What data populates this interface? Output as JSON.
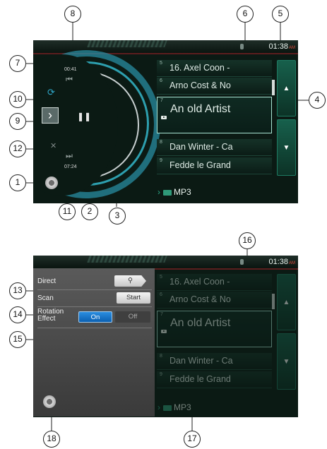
{
  "screen1": {
    "time": "01:38",
    "ampm": "AM",
    "elapsed_time": "00:41",
    "total_time": "07:24",
    "tracks": [
      {
        "num": "5",
        "title": "16. Axel Coon -"
      },
      {
        "num": "6",
        "title": "Arno Cost & No"
      },
      {
        "num": "7",
        "title": "An old  Artist"
      },
      {
        "num": "8",
        "title": "Dan Winter - Ca"
      },
      {
        "num": "9",
        "title": "Fedde le Grand"
      }
    ],
    "folder": "MP3",
    "scroll_up": "▲",
    "scroll_down": "▼",
    "next_icon": "›",
    "pause_icon": "❚❚"
  },
  "screen2": {
    "time": "01:38",
    "ampm": "AM",
    "settings": {
      "direct_label": "Direct",
      "direct_button": "⚲",
      "scan_label": "Scan",
      "scan_button": "Start",
      "rotation_label_1": "Rotation",
      "rotation_label_2": "Effect",
      "rotation_on": "On",
      "rotation_off": "Off"
    },
    "tracks": [
      {
        "num": "5",
        "title": "16. Axel Coon -"
      },
      {
        "num": "6",
        "title": "Arno Cost & No"
      },
      {
        "num": "7",
        "title": "An old  Artist"
      },
      {
        "num": "8",
        "title": "Dan Winter - Ca"
      },
      {
        "num": "9",
        "title": "Fedde le Grand"
      }
    ],
    "folder": "MP3",
    "scroll_up": "▲",
    "scroll_down": "▼"
  },
  "callouts": [
    "1",
    "2",
    "3",
    "4",
    "5",
    "6",
    "7",
    "8",
    "9",
    "10",
    "11",
    "12",
    "13",
    "14",
    "15",
    "16",
    "17",
    "18"
  ],
  "colors": {
    "accent": "#1f8f70",
    "selected": "#0a70c8",
    "ampm": "#d74a3a"
  }
}
